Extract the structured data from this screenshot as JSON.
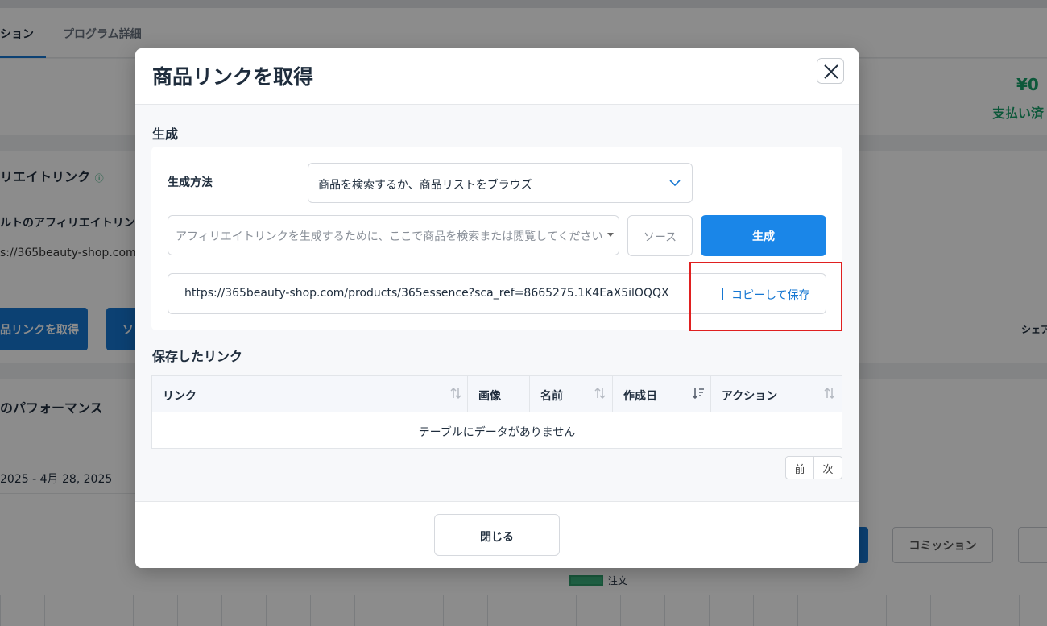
{
  "background": {
    "tabs": [
      "ション",
      "プログラム詳細"
    ],
    "amount": "¥0",
    "paid_label": "支払い済",
    "affiliate_link_title": "リエイトリンク",
    "info_icon": "info-circle-icon",
    "default_link_label": "ルトのアフィリエイトリンク",
    "default_url": "s://365beauty-shop.com",
    "get_link_button": "品リンクを取得",
    "source_button": "ソ",
    "share_label": "シェア",
    "performance_title": "のパフォーマンス",
    "date_range": "2025 - 4月 28, 2025",
    "commission_button": "コミッション",
    "legend_label": "注文"
  },
  "modal": {
    "title": "商品リンクを取得",
    "close_icon": "close-icon",
    "generate_section_label": "生成",
    "method_label": "生成方法",
    "method_selected": "商品を検索するか、商品リストをブラウズ",
    "search_placeholder": "アフィリエイトリンクを生成するために、ここで商品を検索または閲覧してください",
    "source_button": "ソース",
    "generate_button": "生成",
    "generated_link": "https://365beauty-shop.com/products/365essence?sca_ref=8665275.1K4EaX5ilOQQX",
    "copy_save_button": "コピーして保存",
    "saved_section_label": "保存したリンク",
    "table": {
      "columns": [
        "リンク",
        "画像",
        "名前",
        "作成日",
        "アクション"
      ],
      "empty_text": "テーブルにデータがありません"
    },
    "pager": {
      "prev": "前",
      "next": "次"
    },
    "footer_close_button": "閉じる"
  },
  "colors": {
    "primary": "#1a86e8",
    "highlight": "#e02020",
    "success": "#19a06a"
  }
}
